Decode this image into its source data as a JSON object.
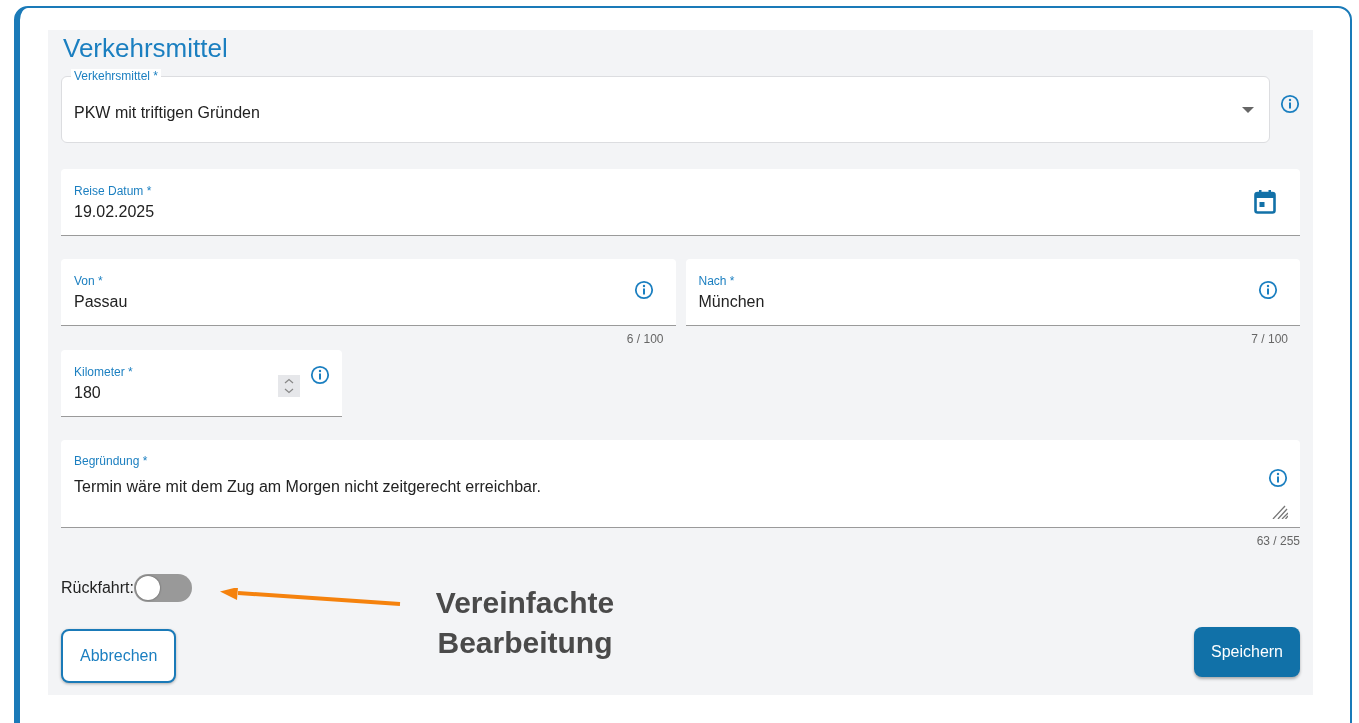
{
  "section_title": "Verkehrsmittel",
  "transport_select": {
    "label": "Verkehrsmittel *",
    "value": "PKW mit triftigen Gründen"
  },
  "travel_date": {
    "label": "Reise Datum *",
    "value": "19.02.2025"
  },
  "from": {
    "label": "Von *",
    "value": "Passau",
    "counter": "6 / 100"
  },
  "to": {
    "label": "Nach *",
    "value": "München",
    "counter": "7 / 100"
  },
  "kilometers": {
    "label": "Kilometer *",
    "value": "180"
  },
  "reason": {
    "label": "Begründung *",
    "value": "Termin wäre mit dem Zug am Morgen nicht zeitgerecht erreichbar.",
    "counter": "63 / 255"
  },
  "return_trip": {
    "label": "Rückfahrt:",
    "on": false
  },
  "buttons": [
    {
      "label": "Abbrechen",
      "kind": "secondary"
    },
    {
      "label": "Speichern",
      "kind": "primary"
    }
  ],
  "annotation": {
    "text": "Vereinfachte Bearbeitung"
  }
}
